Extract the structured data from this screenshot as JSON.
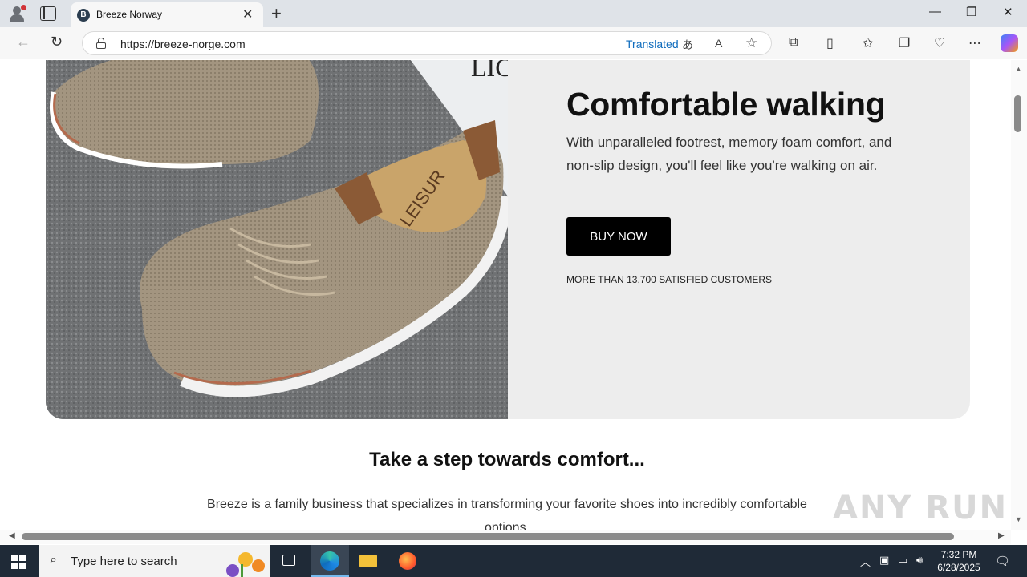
{
  "browser": {
    "tab_title": "Breeze Norway",
    "tab_favicon_letter": "B",
    "url": "https://breeze-norge.com",
    "translated_label": "Translated",
    "window_controls": {
      "minimize": "—",
      "restore": "❐",
      "close": "✕"
    }
  },
  "hero": {
    "title": "Comfortable walking",
    "text": "With unparalleled footrest, memory foam comfort, and non-slip design, you'll feel like you're walking on air.",
    "button_label": "BUY NOW",
    "customers_note": "MORE THAN 13,700 SATISFIED CUSTOMERS",
    "image_text": "LEISUR",
    "backdrop_letters": "LIC A"
  },
  "section": {
    "title": "Take a step towards comfort...",
    "text": "Breeze is a family business that specializes in transforming your favorite shoes into incredibly comfortable options."
  },
  "watermark": "ANY RUN",
  "taskbar": {
    "search_placeholder": "Type here to search",
    "time": "7:32 PM",
    "date": "6/28/2025"
  },
  "colors": {
    "hero_background": "#ededed",
    "button_background": "#000000",
    "translated_link": "#0f6cbd",
    "taskbar": "#1f2a37"
  }
}
